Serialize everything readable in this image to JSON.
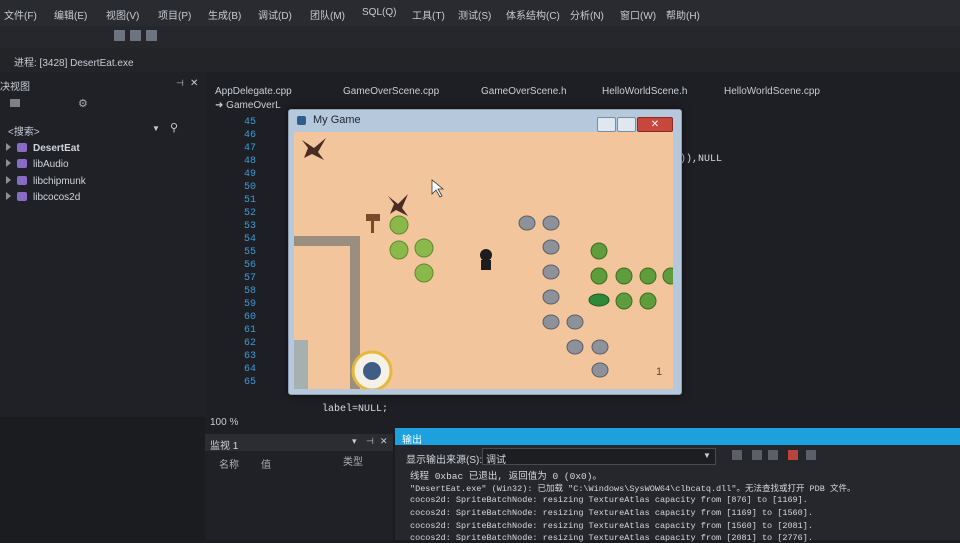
{
  "menu": [
    "文件(F)",
    "编辑(E)",
    "视图(V)",
    "项目(P)",
    "生成(B)",
    "调试(D)",
    "团队(M)",
    "SQL(Q)",
    "工具(T)",
    "测试(S)",
    "体系结构(C)",
    "分析(N)",
    "窗口(W)",
    "帮助(H)"
  ],
  "process_label": "进程: [3428] DesertEat.exe",
  "solution": {
    "title": "决视图",
    "search_label": "<搜索>",
    "items": [
      "DesertEat",
      "libAudio",
      "libchipmunk",
      "libcocos2d"
    ]
  },
  "editor": {
    "tabs": [
      "AppDelegate.cpp",
      "GameOverScene.cpp",
      "GameOverScene.h",
      "HelloWorldScene.h",
      "HelloWorldScene.cpp"
    ],
    "subtab": "GameOverL",
    "line_numbers": [
      "45",
      "46",
      "47",
      "48",
      "49",
      "50",
      "51",
      "52",
      "53",
      "54",
      "55",
      "56",
      "57",
      "58",
      "59",
      "60",
      "61",
      "62",
      "63",
      "64",
      "65"
    ],
    "code_fragment": ")),NULL",
    "code_bottom": "label=NULL;",
    "zoom": "100 %"
  },
  "game": {
    "title": "My Game",
    "score": "1"
  },
  "watch": {
    "title": "监视 1",
    "columns": [
      "名称",
      "值",
      "类型"
    ]
  },
  "output": {
    "title": "输出",
    "source_label": "显示输出来源(S):",
    "source_value": "调试",
    "lines": [
      "线程 0xbac 已退出, 返回值为 0 (0x0)。",
      "\"DesertEat.exe\" (Win32): 已加载 \"C:\\Windows\\SysWOW64\\clbcatq.dll\"。无法查找或打开 PDB 文件。",
      "cocos2d: SpriteBatchNode: resizing TextureAtlas capacity from [876] to [1169].",
      "cocos2d: SpriteBatchNode: resizing TextureAtlas capacity from [1169] to [1560].",
      "cocos2d: SpriteBatchNode: resizing TextureAtlas capacity from [1560] to [2081].",
      "cocos2d: SpriteBatchNode: resizing TextureAtlas capacity from [2081] to [2776]."
    ]
  },
  "colors": {
    "accent": "#1da1dd",
    "ide_bg": "#1e1f24",
    "sand": "#f2c59c"
  },
  "icons": [
    "pause-icon",
    "stop-icon",
    "restart-icon",
    "search-icon",
    "gear-icon",
    "close-icon",
    "cursor-icon",
    "joystick-icon"
  ]
}
